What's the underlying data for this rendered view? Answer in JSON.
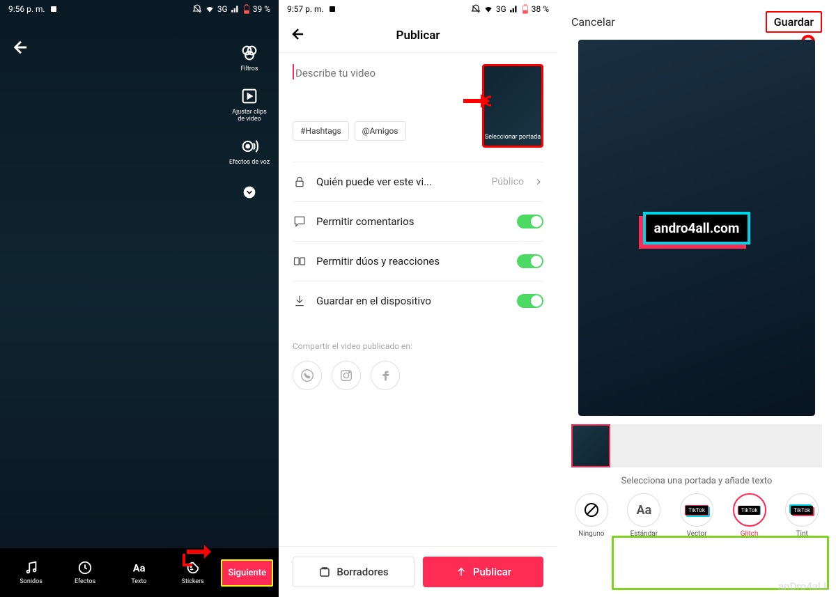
{
  "screen1": {
    "status": {
      "time": "9:56 p. m.",
      "network": "3G",
      "battery": "39 %"
    },
    "tools": {
      "filters": "Filtros",
      "adjustClips": "Ajustar clips de video",
      "voiceEffects": "Efectos de voz"
    },
    "bottom": {
      "sounds": "Sonidos",
      "effects": "Efectos",
      "text": "Texto",
      "stickers": "Stickers",
      "next": "Siguiente"
    }
  },
  "screen2": {
    "status": {
      "time": "9:57 p. m.",
      "network": "3G",
      "battery": "38 %"
    },
    "title": "Publicar",
    "descPlaceholder": "Describe tu video",
    "thumbLabel": "Seleccionar portada",
    "chips": {
      "hashtags": "#Hashtags",
      "friends": "@Amigos"
    },
    "settings": {
      "privacy": {
        "label": "Quién puede ver este vi...",
        "value": "Público"
      },
      "comments": "Permitir comentarios",
      "duets": "Permitir dúos y reacciones",
      "save": "Guardar en el dispositivo"
    },
    "shareLabel": "Compartir el video publicado en:",
    "footer": {
      "drafts": "Borradores",
      "publish": "Publicar"
    }
  },
  "screen3": {
    "cancel": "Cancelar",
    "save": "Guardar",
    "brandText": "andro4all.com",
    "filterLabel": "Selecciona una portada y añade texto",
    "filters": {
      "none": "Ninguno",
      "standard": "Estándar",
      "vector": "Vector",
      "glitch": "Glitch",
      "tint": "Tint"
    },
    "watermark": "anDro4aLL"
  }
}
